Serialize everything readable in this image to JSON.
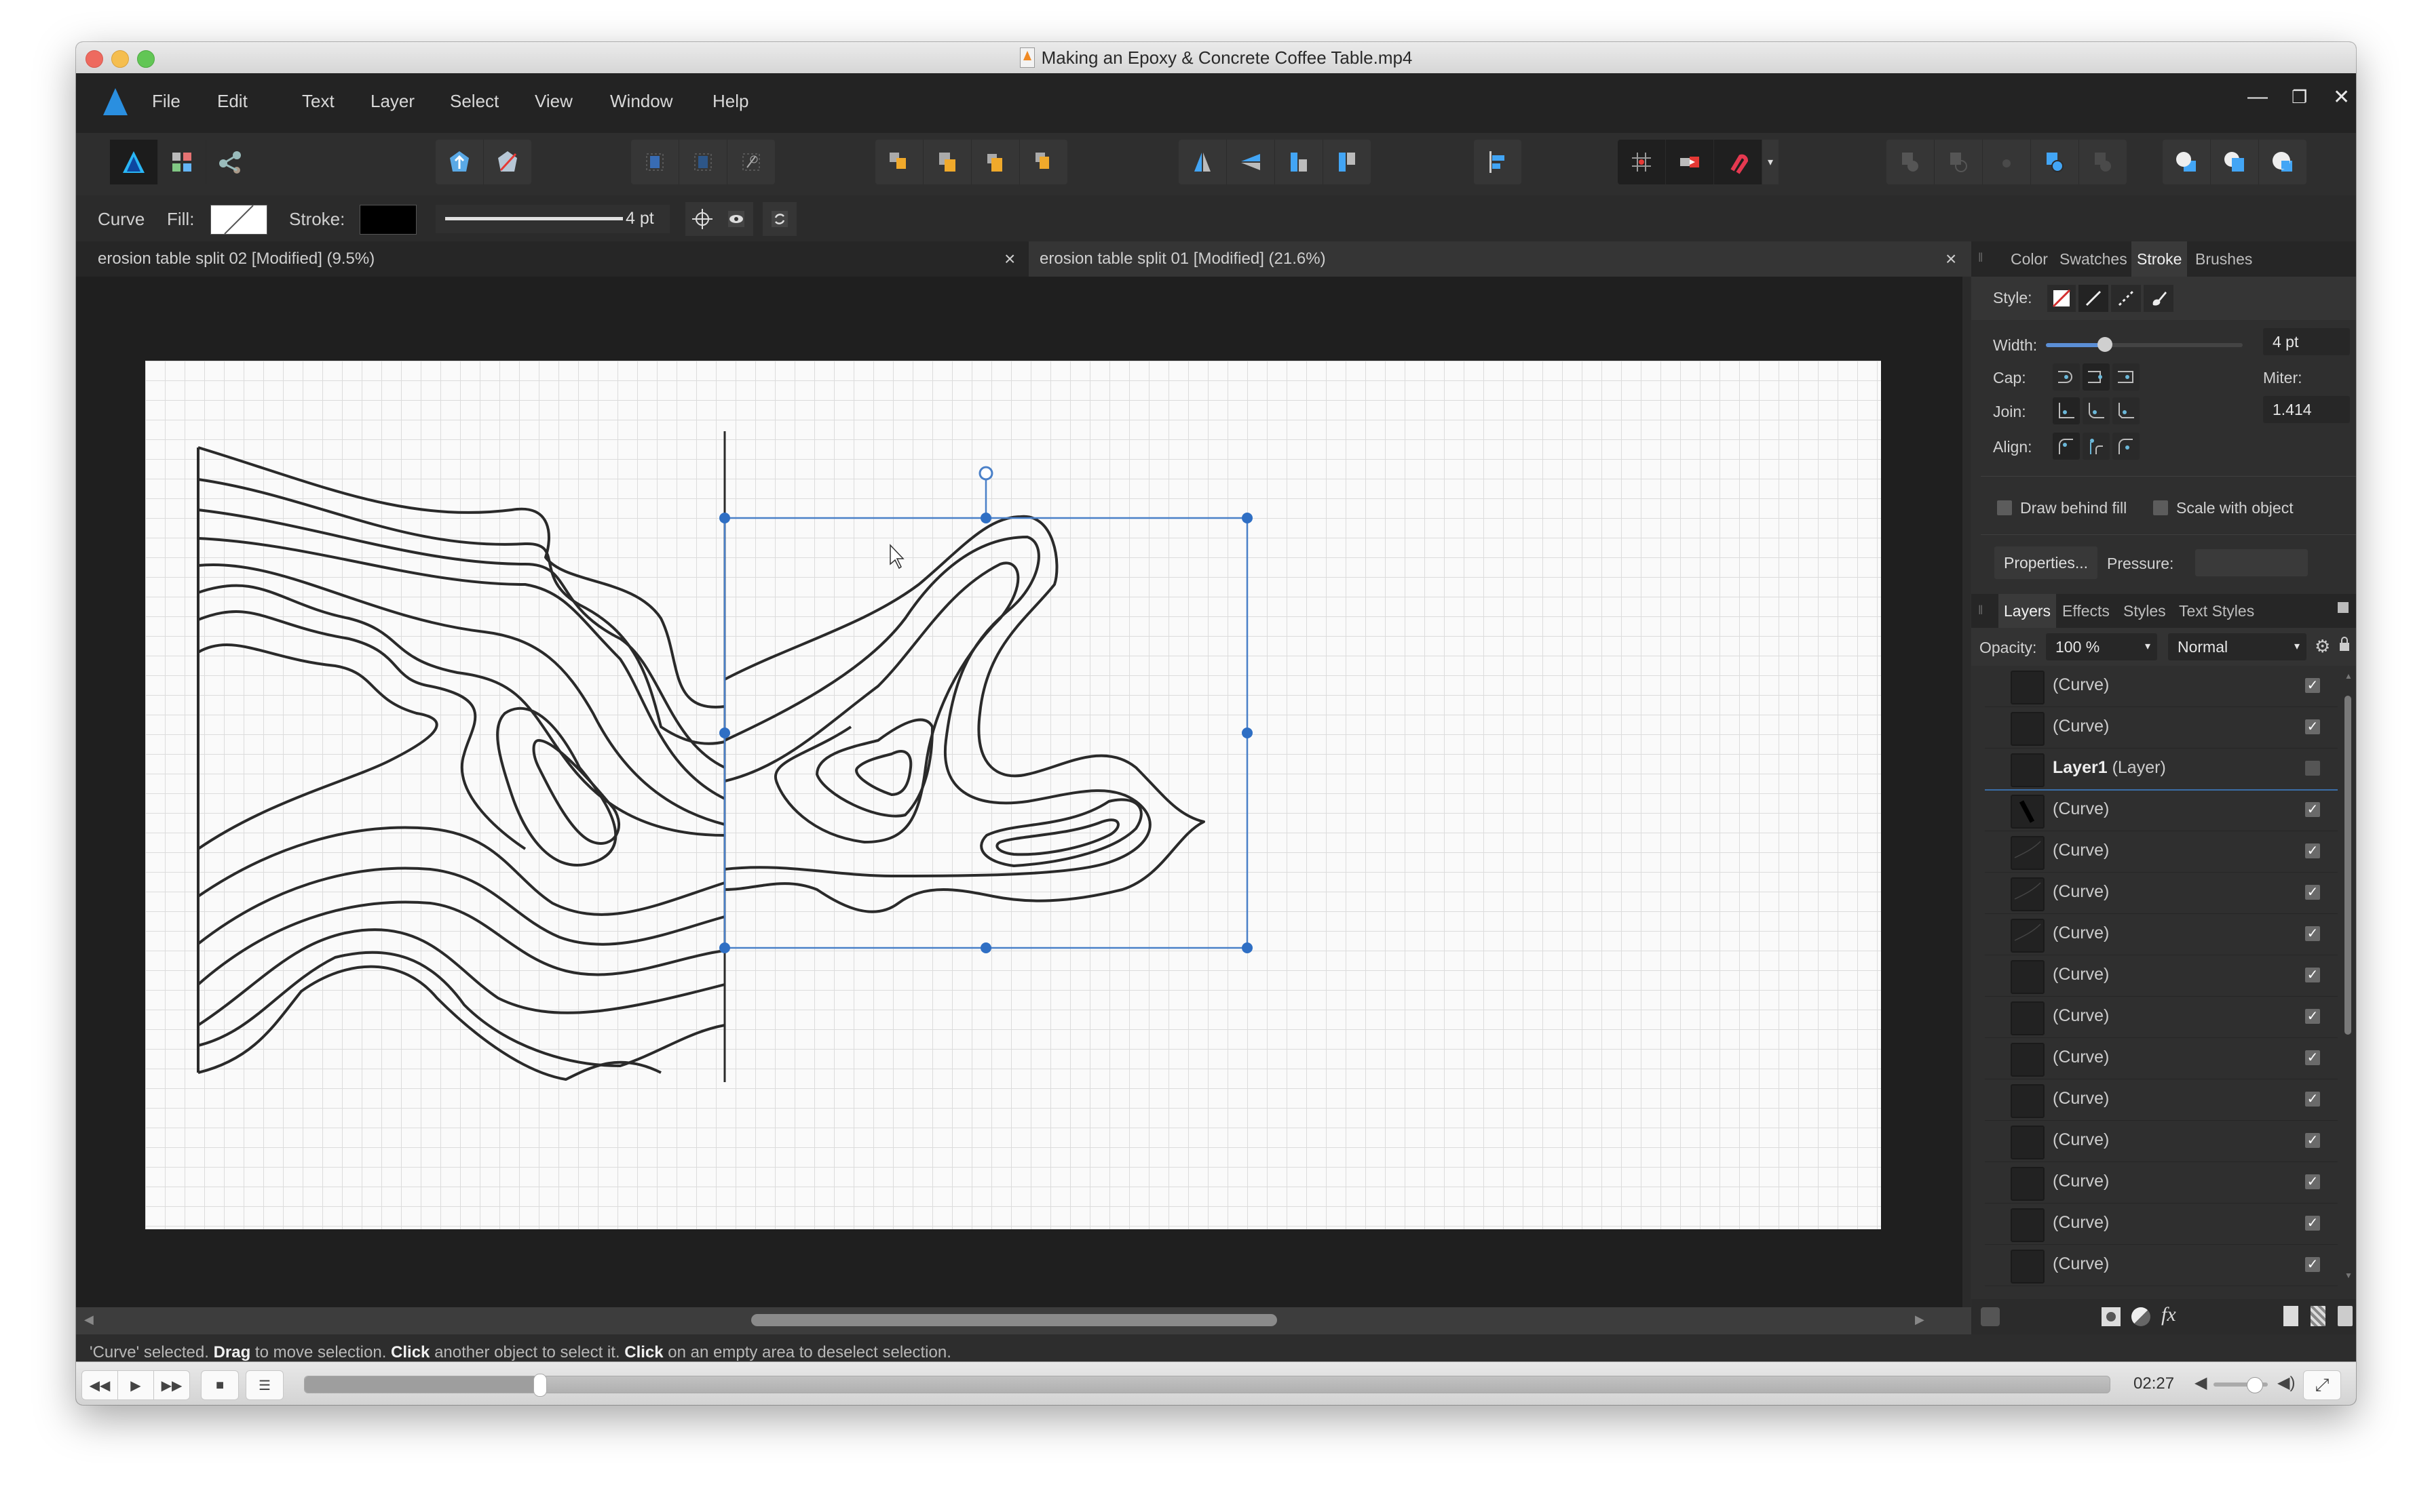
{
  "window": {
    "title": "Making an Epoxy & Concrete Coffee Table.mp4"
  },
  "menubar": {
    "items": [
      "File",
      "Edit",
      "Text",
      "Layer",
      "Select",
      "View",
      "Window",
      "Help"
    ],
    "window_controls": {
      "minimize": "—",
      "restore": "❐",
      "close": "✕"
    }
  },
  "toolbar": {
    "groups": [
      {
        "name": "personas",
        "icons": [
          "designer-persona-icon",
          "pixel-persona-icon",
          "export-persona-icon"
        ]
      },
      {
        "name": "snapshot",
        "icons": [
          "flood-fill-icon",
          "erase-icon"
        ]
      },
      {
        "name": "transform",
        "icons": [
          "transform-grid-icon",
          "transform-bounds-icon",
          "transform-rotate-icon"
        ]
      },
      {
        "name": "arrange",
        "icons": [
          "move-to-back-icon",
          "move-back-one-icon",
          "move-forward-one-icon",
          "move-to-front-icon"
        ]
      },
      {
        "name": "flip",
        "icons": [
          "flip-horizontal-icon",
          "flip-vertical-icon",
          "rotate-left-icon",
          "rotate-right-icon"
        ]
      },
      {
        "name": "align",
        "icons": [
          "align-icon"
        ]
      },
      {
        "name": "snapping",
        "icons": [
          "snap-grid-icon",
          "snap-move-icon",
          "snapping-magnet-icon"
        ]
      },
      {
        "name": "boolean",
        "icons": [
          "add-icon",
          "subtract-icon",
          "intersect-icon",
          "xor-icon",
          "divide-icon"
        ]
      },
      {
        "name": "assistants",
        "icons": [
          "insert-behind-icon",
          "insert-inside-icon",
          "insert-top-icon"
        ]
      }
    ]
  },
  "context": {
    "tool_label": "Curve",
    "fill_label": "Fill:",
    "stroke_label": "Stroke:",
    "stroke_width": "4 pt",
    "fill_color": "none",
    "stroke_color": "#000000"
  },
  "documents": {
    "tabs": [
      {
        "label": "erosion table split 02 [Modified] (9.5%)",
        "active": false
      },
      {
        "label": "erosion table split 01 [Modified] (21.6%)",
        "active": true
      }
    ],
    "close_glyph": "×"
  },
  "stroke_panel": {
    "tabs": [
      "Color",
      "Swatches",
      "Stroke",
      "Brushes"
    ],
    "active_tab": "Stroke",
    "style_label": "Style:",
    "width_label": "Width:",
    "width_value": "4 pt",
    "width_slider_fraction": 0.3,
    "cap_label": "Cap:",
    "join_label": "Join:",
    "align_label": "Align:",
    "miter_label": "Miter:",
    "miter_value": "1.414",
    "draw_behind_fill": "Draw behind fill",
    "scale_with_object": "Scale with object",
    "properties_button": "Properties...",
    "pressure_label": "Pressure:"
  },
  "layers_panel": {
    "tabs": [
      "Layers",
      "Effects",
      "Styles",
      "Text Styles"
    ],
    "active_tab": "Layers",
    "opacity_label": "Opacity:",
    "opacity_value": "100 %",
    "blend_mode": "Normal",
    "rows": [
      {
        "name": "(Curve)",
        "bold": "",
        "visible": true
      },
      {
        "name": "(Curve)",
        "bold": "",
        "visible": true
      },
      {
        "name": "(Layer)",
        "bold": "Layer1",
        "visible": false
      },
      {
        "name": "(Curve)",
        "bold": "",
        "visible": true
      },
      {
        "name": "(Curve)",
        "bold": "",
        "visible": true
      },
      {
        "name": "(Curve)",
        "bold": "",
        "visible": true
      },
      {
        "name": "(Curve)",
        "bold": "",
        "visible": true
      },
      {
        "name": "(Curve)",
        "bold": "",
        "visible": true
      },
      {
        "name": "(Curve)",
        "bold": "",
        "visible": true
      },
      {
        "name": "(Curve)",
        "bold": "",
        "visible": true
      },
      {
        "name": "(Curve)",
        "bold": "",
        "visible": true
      },
      {
        "name": "(Curve)",
        "bold": "",
        "visible": true
      },
      {
        "name": "(Curve)",
        "bold": "",
        "visible": true
      },
      {
        "name": "(Curve)",
        "bold": "",
        "visible": true
      },
      {
        "name": "(Curve)",
        "bold": "",
        "visible": true
      }
    ],
    "check_glyph": "✓"
  },
  "status": {
    "parts": [
      {
        "text": "'Curve' selected. ",
        "bold": false
      },
      {
        "text": "Drag",
        "bold": true
      },
      {
        "text": " to move selection. ",
        "bold": false
      },
      {
        "text": "Click",
        "bold": true
      },
      {
        "text": " another object to select it. ",
        "bold": false
      },
      {
        "text": "Click",
        "bold": true
      },
      {
        "text": " on an empty area to deselect selection.",
        "bold": false
      }
    ]
  },
  "video": {
    "time": "02:27",
    "progress_fraction": 0.13,
    "volume_fraction": 0.75,
    "buttons": {
      "rewind": "◀◀",
      "play": "▶",
      "forward": "▶▶",
      "stop": "■",
      "playlist": "☰",
      "fullscreen": "⤢"
    }
  }
}
